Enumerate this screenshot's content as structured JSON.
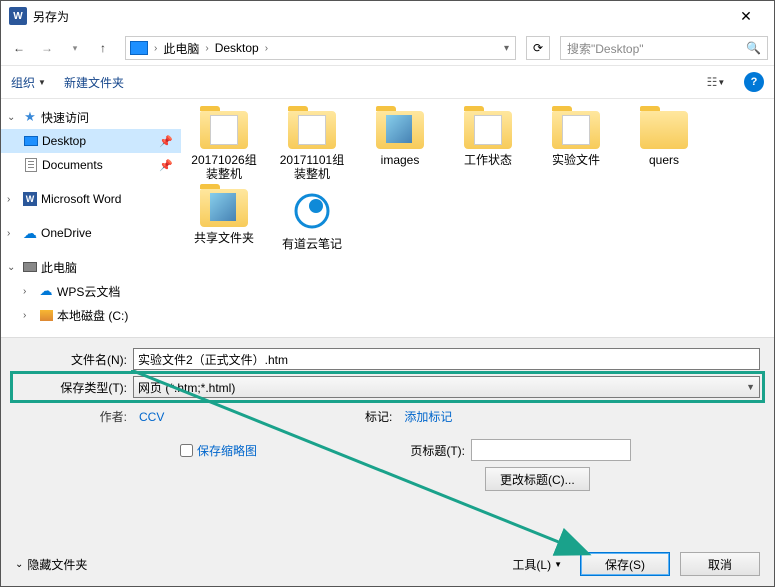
{
  "title": "另存为",
  "breadcrumb": {
    "root": "此电脑",
    "folder": "Desktop"
  },
  "search_placeholder": "搜索\"Desktop\"",
  "toolbar": {
    "organize": "组织",
    "new_folder": "新建文件夹"
  },
  "sidebar": {
    "quick_access": "快速访问",
    "desktop": "Desktop",
    "documents": "Documents",
    "word": "Microsoft Word",
    "onedrive": "OneDrive",
    "this_pc": "此电脑",
    "wps": "WPS云文档",
    "local_disk": "本地磁盘 (C:)"
  },
  "files": [
    {
      "label": "20171026组装整机",
      "kind": "folder-doc"
    },
    {
      "label": "20171101组装整机",
      "kind": "folder-doc"
    },
    {
      "label": "images",
      "kind": "folder-img"
    },
    {
      "label": "工作状态",
      "kind": "folder-doc"
    },
    {
      "label": "实验文件",
      "kind": "folder-doc"
    },
    {
      "label": "quers",
      "kind": "folder"
    },
    {
      "label": "共享文件夹",
      "kind": "folder-img"
    },
    {
      "label": "有道云笔记",
      "kind": "qq"
    }
  ],
  "filename_label": "文件名(N):",
  "filename_value": "实验文件2（正式文件）.htm",
  "filetype_label": "保存类型(T):",
  "filetype_value": "网页 (*.htm;*.html)",
  "author_label": "作者:",
  "author_value": "CCV",
  "tags_label": "标记:",
  "tags_value": "添加标记",
  "save_thumbnail": "保存缩略图",
  "page_title_label": "页标题(T):",
  "change_title": "更改标题(C)...",
  "hide_folders": "隐藏文件夹",
  "tools": "工具(L)",
  "save": "保存(S)",
  "cancel": "取消"
}
